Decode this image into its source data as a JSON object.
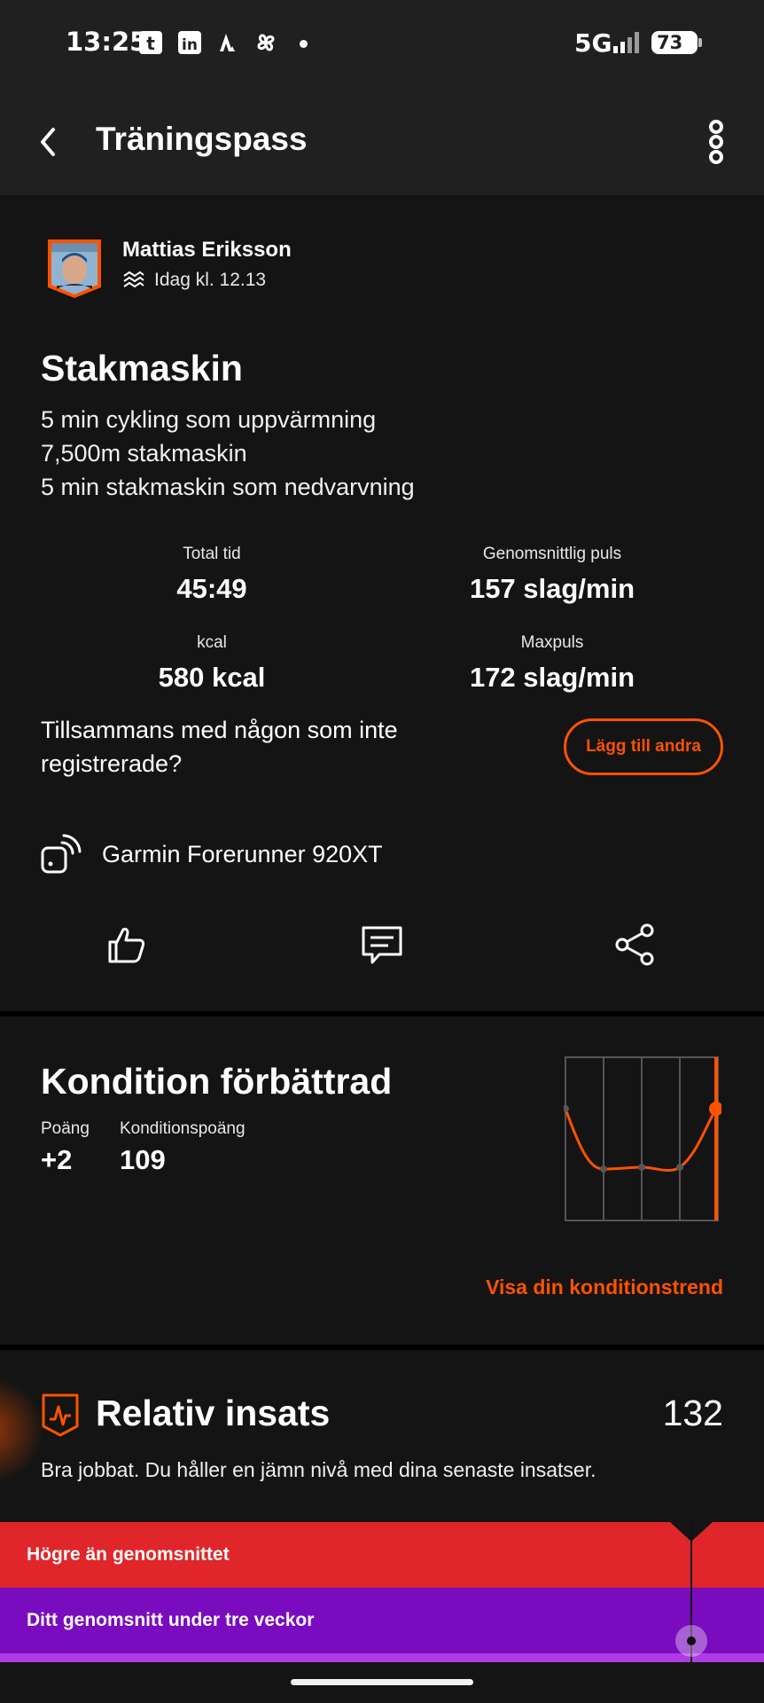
{
  "status_bar": {
    "time": "13:25",
    "network": "5G",
    "battery": "73",
    "icons": [
      "tumblr-icon",
      "linkedin-icon",
      "strava-icon",
      "pinwheel-icon"
    ]
  },
  "header": {
    "title": "Träningspass"
  },
  "activity": {
    "athlete_name": "Mattias Eriksson",
    "timestamp": "Idag kl. 12.13",
    "title": "Stakmaskin",
    "description": [
      "5 min cykling som uppvärmning",
      "7,500m stakmaskin",
      "5 min stakmaskin som nedvarvning"
    ],
    "stats": [
      {
        "label": "Total tid",
        "value": "45:49"
      },
      {
        "label": "Genomsnittlig puls",
        "value": "157 slag/min"
      },
      {
        "label": "kcal",
        "value": "580 kcal"
      },
      {
        "label": "Maxpuls",
        "value": "172 slag/min"
      }
    ],
    "together_text": "Tillsammans med någon som inte registrerade?",
    "add_others_label": "Lägg till andra",
    "device": "Garmin Forerunner 920XT"
  },
  "fitness": {
    "title": "Kondition förbättrad",
    "points_label": "Poäng",
    "points_value": "+2",
    "fitness_label": "Konditionspoäng",
    "fitness_value": "109",
    "link_label": "Visa din konditionstrend"
  },
  "effort": {
    "title": "Relativ insats",
    "score": "132",
    "description": "Bra jobbat. Du håller en jämn nivå med dina senaste insatser.",
    "band_high": "Högre än genomsnittet",
    "band_avg": "Ditt genomsnitt under tre veckor"
  },
  "colors": {
    "accent": "#fc5200",
    "band_high": "#e0262a",
    "band_avg": "#7a0bbf",
    "background": "#141414",
    "header": "#202020"
  }
}
